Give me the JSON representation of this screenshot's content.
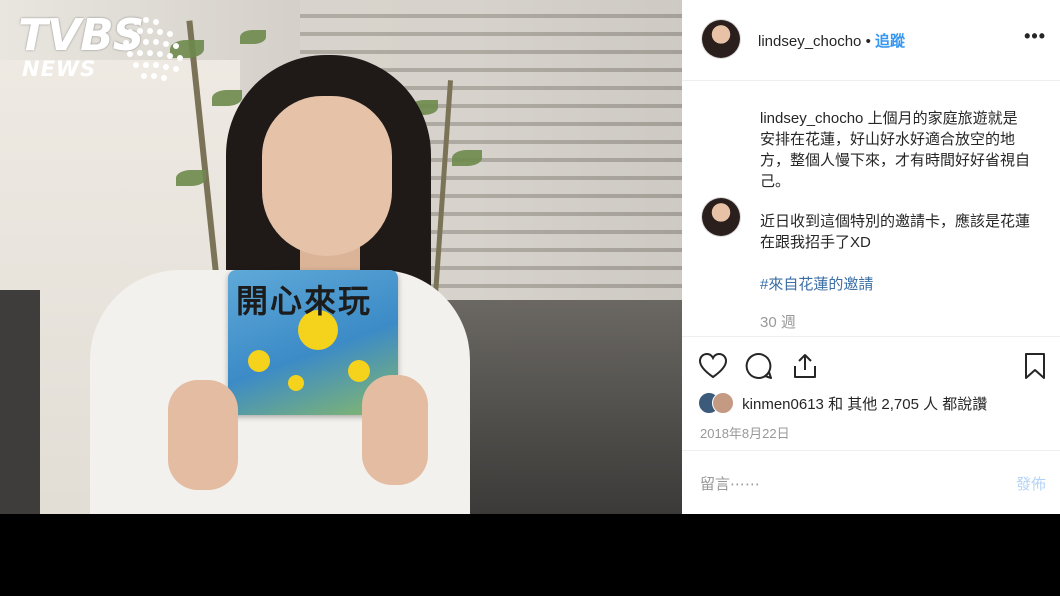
{
  "logo": {
    "brand": "TVBS",
    "sub": "NEWS"
  },
  "photo": {
    "card_text": "開心來玩"
  },
  "post": {
    "username": "lindsey_chocho",
    "separator": "•",
    "follow_label": "追蹤",
    "more_label": "•••",
    "caption_user": "lindsey_chocho",
    "caption_text": "上個月的家庭旅遊就是安排在花蓮，好山好水好適合放空的地方，整個人慢下來，才有時間好好省視自己。",
    "comment_text": "近日收到這個特別的邀請卡，應該是花蓮在跟我招手了XD",
    "hashtag": "#來自花蓮的邀請",
    "time_ago": "30 週",
    "likes_user": "kinmen0613",
    "likes_mid": " 和 ",
    "likes_others": "其他 2,705 人",
    "likes_suffix": " 都說讚",
    "date": "2018年8月22日",
    "comment_placeholder": "留言⋯⋯",
    "post_label": "發佈"
  },
  "icons": [
    "heart-icon",
    "comment-icon",
    "share-icon",
    "bookmark-icon"
  ]
}
